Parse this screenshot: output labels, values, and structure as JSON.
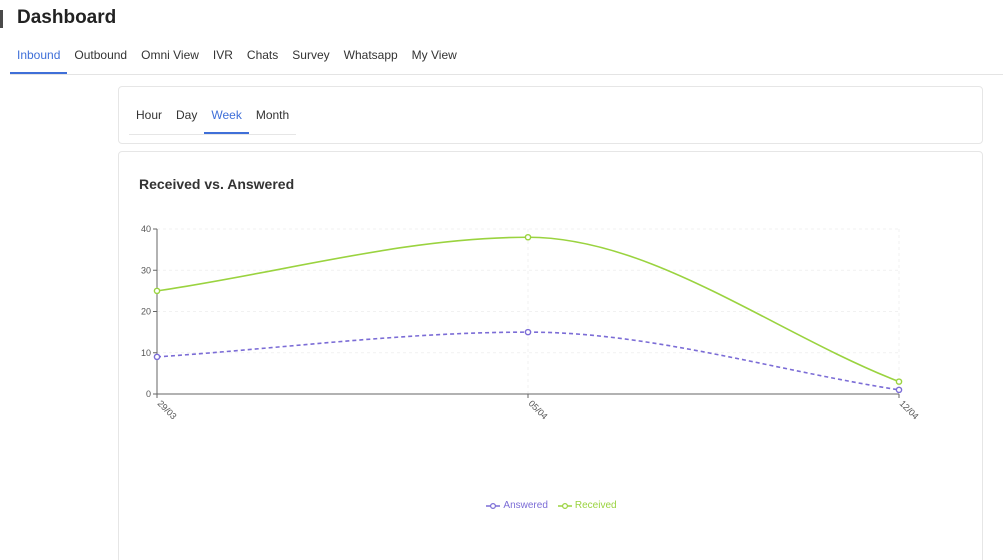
{
  "page": {
    "title": "Dashboard"
  },
  "tabs": [
    {
      "label": "Inbound",
      "active": true
    },
    {
      "label": "Outbound",
      "active": false
    },
    {
      "label": "Omni View",
      "active": false
    },
    {
      "label": "IVR",
      "active": false
    },
    {
      "label": "Chats",
      "active": false
    },
    {
      "label": "Survey",
      "active": false
    },
    {
      "label": "Whatsapp",
      "active": false
    },
    {
      "label": "My View",
      "active": false
    }
  ],
  "period_tabs": [
    {
      "label": "Hour",
      "active": false
    },
    {
      "label": "Day",
      "active": false
    },
    {
      "label": "Week",
      "active": true
    },
    {
      "label": "Month",
      "active": false
    }
  ],
  "colors": {
    "accent": "#3f6fd8",
    "answered": "#7b6cd6",
    "received": "#9ad33f"
  },
  "chart_data": {
    "type": "line",
    "title": "Received vs. Answered",
    "categories": [
      "29/03",
      "05/04",
      "12/04"
    ],
    "ylim": [
      0,
      40
    ],
    "yticks": [
      "0",
      "10",
      "20",
      "30",
      "40"
    ],
    "grid": true,
    "legend_position": "bottom-center",
    "series": [
      {
        "name": "Answered",
        "values": [
          9,
          15,
          1
        ],
        "color": "#7b6cd6",
        "dashed": true
      },
      {
        "name": "Received",
        "values": [
          25,
          38,
          3
        ],
        "color": "#9ad33f",
        "dashed": false
      }
    ]
  }
}
